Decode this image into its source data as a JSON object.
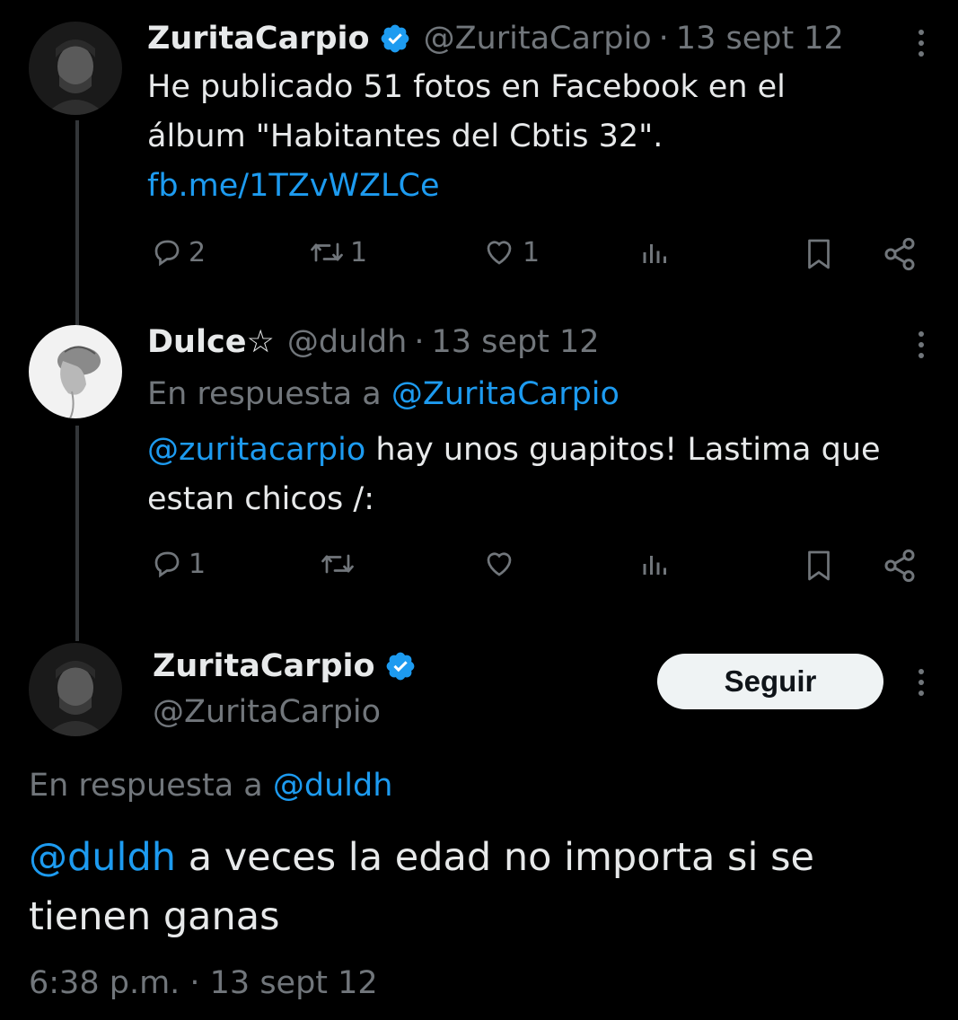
{
  "tweets": [
    {
      "display_name": "ZuritaCarpio",
      "handle": "@ZuritaCarpio",
      "separator": "·",
      "date": "13 sept 12",
      "text_before": "He publicado 51 fotos en Facebook en el álbum \"Habitantes del Cbtis 32\". ",
      "link": "fb.me/1TZvWZLCe",
      "reply_count": "2",
      "retweet_count": "1",
      "like_count": "1"
    },
    {
      "display_name": "Dulce☆",
      "handle": "@duldh",
      "separator": "·",
      "date": "13 sept 12",
      "reply_prefix": "En respuesta a ",
      "reply_to": "@ZuritaCarpio",
      "mention": "@zuritacarpio",
      "text_after": " hay unos guapitos! Lastima que estan chicos /:",
      "reply_count": "1"
    }
  ],
  "main_tweet": {
    "display_name": "ZuritaCarpio",
    "handle": "@ZuritaCarpio",
    "follow_label": "Seguir",
    "reply_prefix": "En respuesta a ",
    "reply_to": "@duldh",
    "mention": "@duldh",
    "text_after": " a veces la edad no importa si se tienen ganas",
    "timestamp": "6:38 p.m. · 13 sept 12"
  },
  "colors": {
    "background": "#000000",
    "text": "#e7e9ea",
    "muted": "#71767b",
    "link": "#1d9bf0",
    "verified": "#1d9bf0"
  },
  "icons": [
    "reply-icon",
    "retweet-icon",
    "like-icon",
    "views-icon",
    "bookmark-icon",
    "share-icon",
    "more-icon",
    "verified-badge-icon"
  ]
}
